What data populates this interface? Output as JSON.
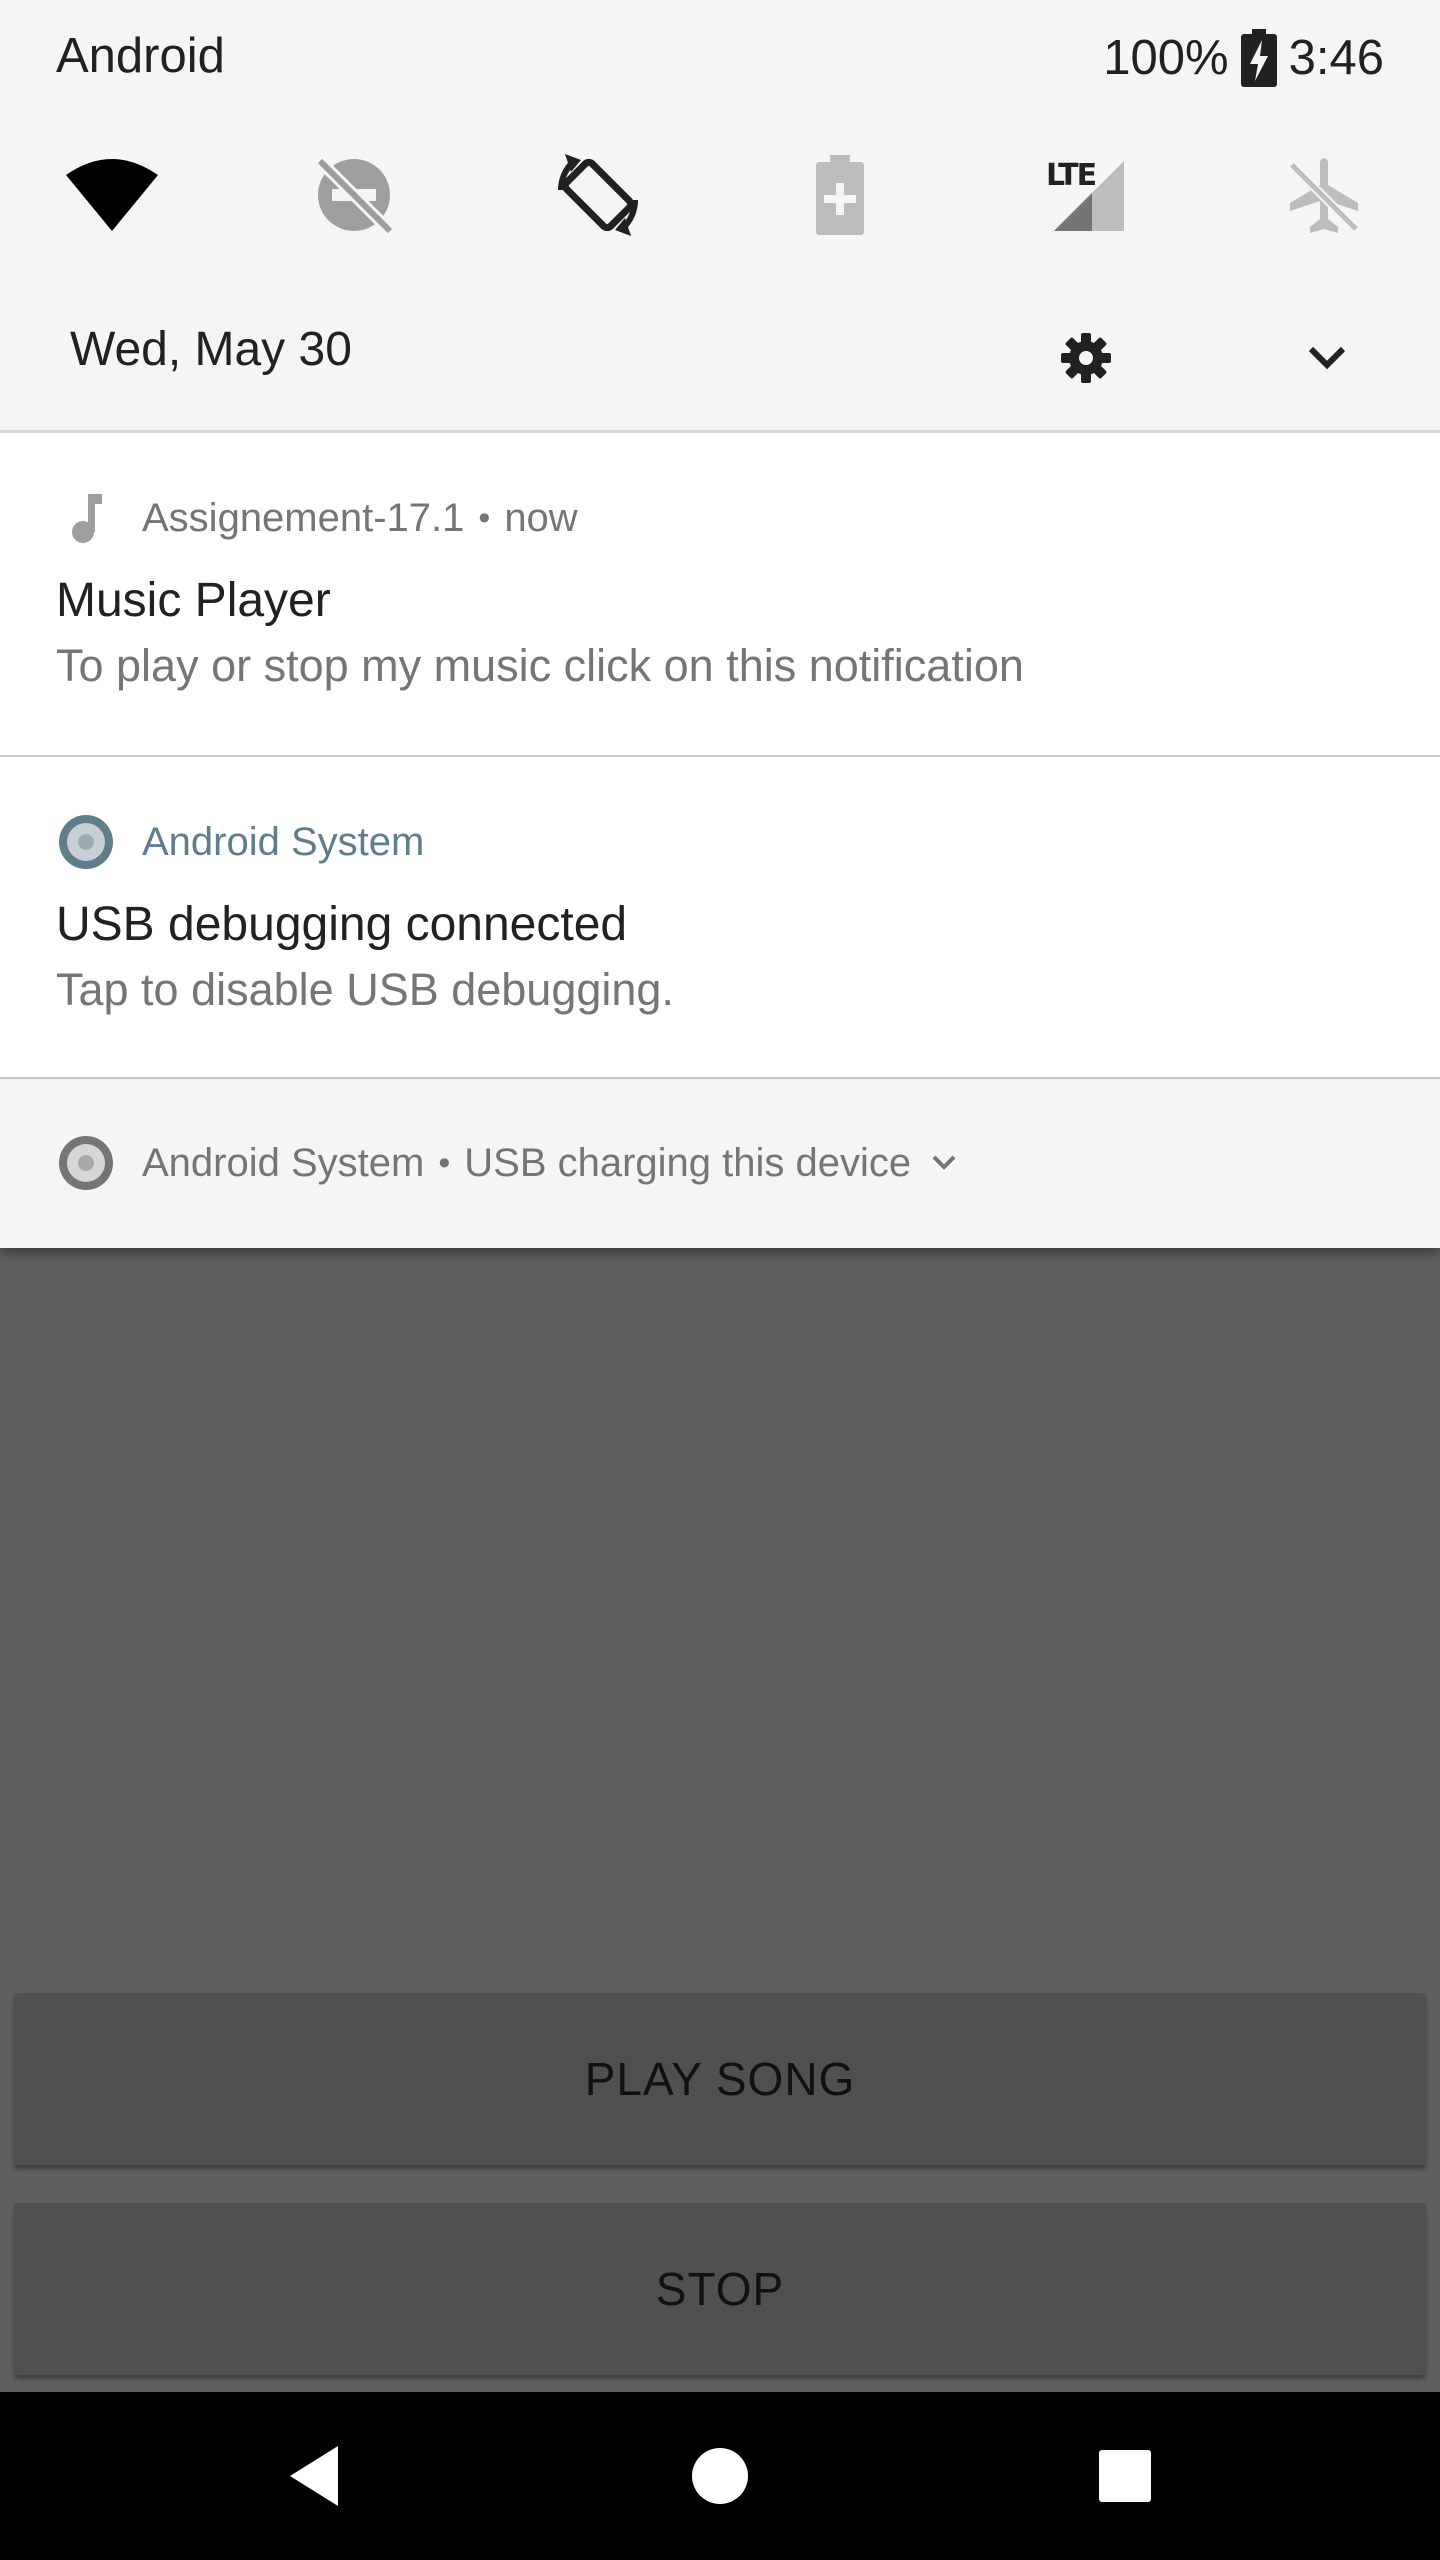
{
  "status_bar": {
    "carrier": "Android",
    "battery": "100%",
    "time": "3:46",
    "icons": [
      "battery-charging-icon"
    ]
  },
  "quick_settings": {
    "tiles": [
      {
        "name": "wifi",
        "icon": "wifi-icon"
      },
      {
        "name": "do-not-disturb-off",
        "icon": "dnd-off-icon"
      },
      {
        "name": "auto-rotate",
        "icon": "auto-rotate-icon"
      },
      {
        "name": "battery-saver",
        "icon": "battery-saver-icon"
      },
      {
        "name": "mobile-data",
        "icon": "lte-signal-icon",
        "label": "LTE"
      },
      {
        "name": "airplane-mode",
        "icon": "airplane-mode-icon"
      }
    ]
  },
  "header": {
    "date": "Wed, May 30",
    "settings_icon": "gear-icon",
    "expand_icon": "chevron-down-icon"
  },
  "notifications": [
    {
      "app": "Assignement-17.1",
      "time": "now",
      "icon": "music-note-icon",
      "title": "Music Player",
      "text": "To play or stop my music click on this notification"
    },
    {
      "app": "Android System",
      "icon": "android-system-icon",
      "title": "USB debugging connected",
      "text": "Tap to disable USB debugging."
    },
    {
      "app": "Android System",
      "icon": "android-system-icon",
      "summary": "USB charging this device"
    }
  ],
  "app": {
    "play_label": "PLAY SONG",
    "stop_label": "STOP"
  },
  "nav": {
    "back": "back-icon",
    "home": "home-icon",
    "recents": "recents-icon"
  },
  "colors": {
    "shade": "#f5f5f5",
    "card": "#ffffff",
    "accent": "#607d8b",
    "scrim": "#606060",
    "button": "#4f504f",
    "navbar": "#000000"
  }
}
